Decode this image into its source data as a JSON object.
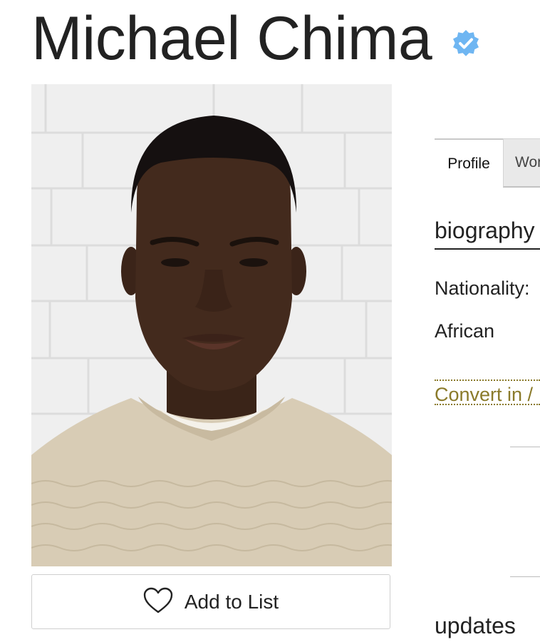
{
  "profile": {
    "name": "Michael Chima",
    "verified_icon": "verified-badge-icon",
    "accent_color": "#6fb6f2",
    "photo_icon": "model-portrait-photo"
  },
  "actions": {
    "add_to_list_label": "Add to List",
    "add_to_list_icon": "heart-icon"
  },
  "tabs": [
    {
      "label": "Profile",
      "active": true
    },
    {
      "label": "Wor",
      "active": false
    }
  ],
  "biography": {
    "heading": "biography",
    "nationality_label": "Nationality:",
    "nationality_value": "African",
    "convert_link": "Convert in /",
    "link_color": "#8a7a2a"
  },
  "updates": {
    "heading": "updates"
  }
}
